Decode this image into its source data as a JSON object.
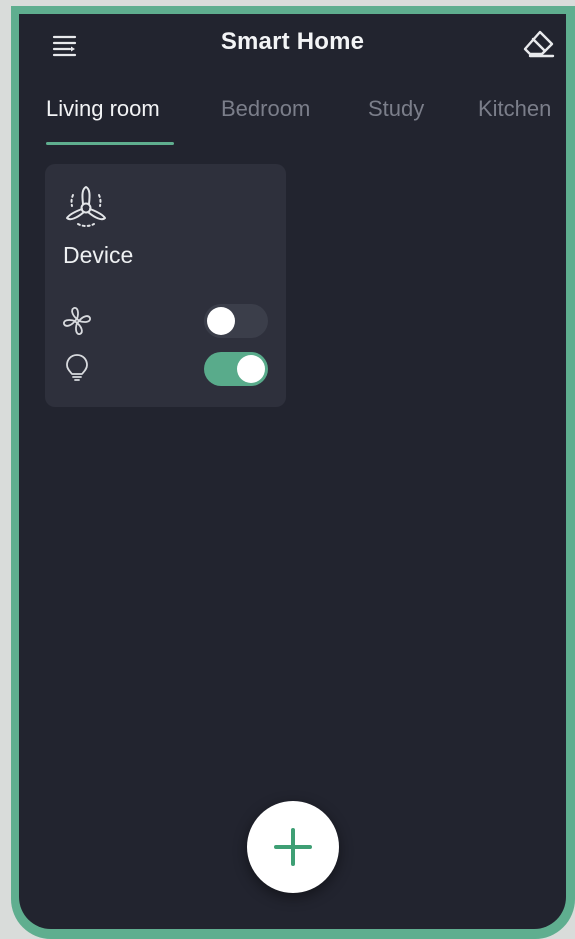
{
  "app": {
    "title": "Smart Home"
  },
  "header": {
    "menu_icon": "menu-icon",
    "erase_icon": "eraser-icon"
  },
  "tabs": [
    {
      "label": "Living room",
      "active": true
    },
    {
      "label": "Bedroom",
      "active": false
    },
    {
      "label": "Study",
      "active": false
    },
    {
      "label": "Kitchen",
      "active": false
    }
  ],
  "device_card": {
    "icon": "ceiling-fan-icon",
    "title": "Device",
    "controls": [
      {
        "icon": "fan-icon",
        "on": false
      },
      {
        "icon": "lightbulb-icon",
        "on": true
      }
    ]
  },
  "fab": {
    "icon": "plus-icon"
  },
  "colors": {
    "accent": "#5fae8f",
    "background": "#22242f",
    "card": "#2e303c",
    "toggle_off": "#3b3e4a",
    "toggle_on": "#59ab8b"
  }
}
